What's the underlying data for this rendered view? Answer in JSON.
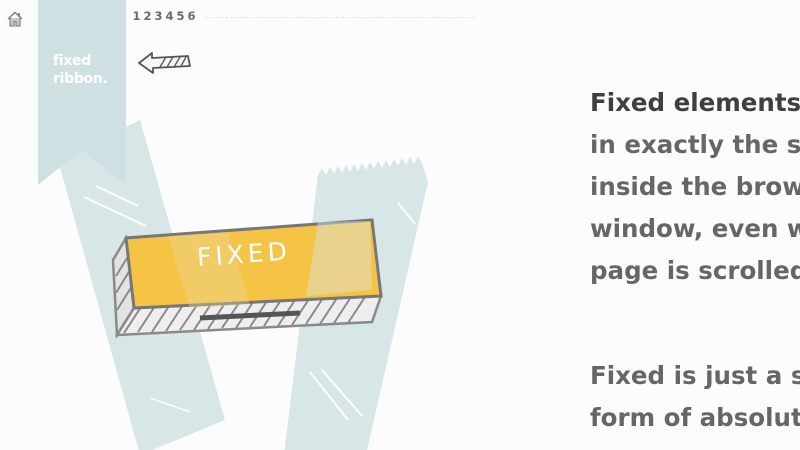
{
  "nav": {
    "home_icon": "home-icon",
    "pages": [
      "1",
      "2",
      "3",
      "4",
      "5",
      "6"
    ]
  },
  "ribbon": {
    "line1": "fixed",
    "line2": "ribbon.",
    "color": "#cfe0e2"
  },
  "arrow_icon": "arrow-left-icon",
  "illustration": {
    "label": "FIXED",
    "block_color": "#f6c445",
    "tape_color": "#d6e5e6"
  },
  "content": {
    "para1": {
      "emphasis": "Fixed elements",
      "line2": "in exactly the sa",
      "line3": "inside the brows",
      "line4": "window, even w",
      "line5": "page is scrolled."
    },
    "para2": {
      "line1": "Fixed is just a sp",
      "line2": "form of absolut"
    }
  }
}
